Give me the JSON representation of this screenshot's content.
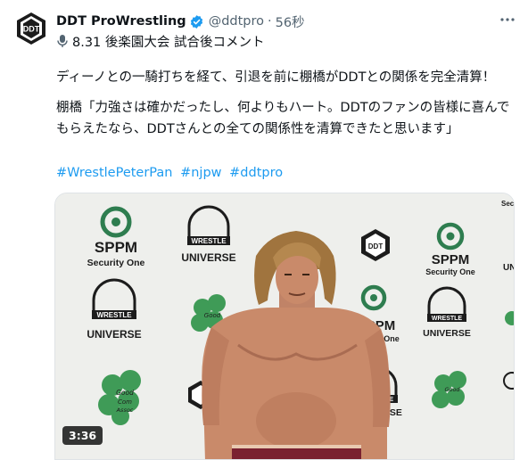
{
  "tweet": {
    "author": {
      "name": "DDT ProWrestling",
      "handle": "@ddtpro",
      "avatar_text": "DDT",
      "verified_icon": "verified-badge-icon"
    },
    "time": "56秒",
    "separator": "·",
    "subline": {
      "icon": "microphone-icon",
      "text": "8.31 後楽園大会 試合後コメント"
    },
    "paragraphs": [
      "ディーノとの一騎打ちを経て、引退を前に棚橋がDDTとの関係を完全清算！",
      "棚橋「力強さは確かだったし、何よりもハート。DDTのファンの皆様に喜んでもらえたなら、DDTさんとの全ての関係性を清算できたと思います」"
    ],
    "hashtags": [
      "#WrestlePeterPan",
      "#njpw",
      "#ddtpro"
    ],
    "video": {
      "duration": "3:36",
      "backdrop_logos": {
        "sponsor_name": "SPPM",
        "sponsor_sub": "Security One",
        "universe_top": "WRESTLE",
        "universe_bottom": "UNIVERSE",
        "good_com_line1": "Good",
        "good_com_line2": "Com",
        "good_com_line3": "Assoc",
        "ddt_letters": "DDT",
        "corner_text": "Securi",
        "partial_u": "UNI"
      }
    }
  },
  "colors": {
    "link": "#1d9bf0",
    "secondary_text": "#536471",
    "sppm_green": "#2e7d4f",
    "skin": "#c98a6a"
  }
}
